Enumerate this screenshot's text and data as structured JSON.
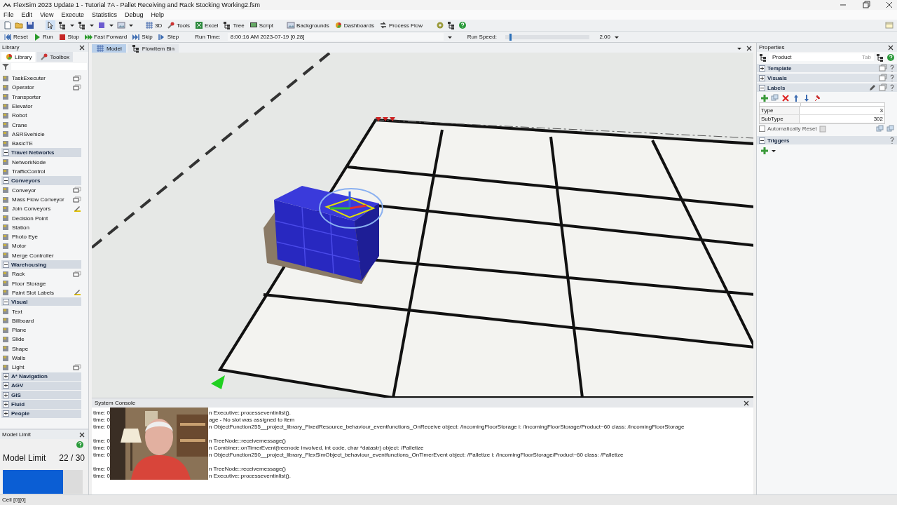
{
  "window": {
    "title": "FlexSim 2023 Update 1 - Tutorial 7A - Pallet Receiving and Rack Stocking Working2.fsm"
  },
  "menu": [
    "File",
    "Edit",
    "View",
    "Execute",
    "Statistics",
    "Debug",
    "Help"
  ],
  "toolbar": {
    "buttons": [
      {
        "label": "3D"
      },
      {
        "label": "Tools"
      },
      {
        "label": "Excel"
      },
      {
        "label": "Tree"
      },
      {
        "label": "Script"
      },
      {
        "label": "Backgrounds"
      },
      {
        "label": "Dashboards"
      },
      {
        "label": "Process Flow"
      }
    ]
  },
  "run_controls": {
    "buttons": [
      "Reset",
      "Run",
      "Stop",
      "Fast Forward",
      "Skip",
      "Step"
    ],
    "run_time_label": "Run Time:",
    "run_time": "8:00:16 AM  2023-07-19  [0.28]",
    "run_speed_label": "Run Speed:",
    "run_speed": {
      "level": 0.05
    },
    "run_speed_value": "2.00"
  },
  "library": {
    "title": "Library",
    "tabs": [
      {
        "label": "Library",
        "selected": true
      },
      {
        "label": "Toolbox",
        "selected": false
      }
    ],
    "items": [
      {
        "kind": "placeable",
        "label": "TaskExecuter"
      },
      {
        "kind": "placeable",
        "label": "Operator"
      },
      {
        "kind": "object",
        "label": "Transporter"
      },
      {
        "kind": "object",
        "label": "Elevator"
      },
      {
        "kind": "object",
        "label": "Robot"
      },
      {
        "kind": "object",
        "label": "Crane"
      },
      {
        "kind": "object",
        "label": "ASRSvehicle"
      },
      {
        "kind": "object",
        "label": "BasicTE"
      },
      {
        "kind": "category",
        "label": "Travel Networks",
        "expanded": true,
        "children": [
          {
            "kind": "object",
            "label": "NetworkNode"
          },
          {
            "kind": "object",
            "label": "TrafficControl"
          }
        ]
      },
      {
        "kind": "category",
        "label": "Conveyors",
        "expanded": true,
        "children": [
          {
            "kind": "placeable",
            "label": "Conveyor"
          },
          {
            "kind": "placeable",
            "label": "Mass Flow Conveyor"
          },
          {
            "kind": "tool",
            "label": "Join Conveyors"
          },
          {
            "kind": "object",
            "label": "Decision Point"
          },
          {
            "kind": "object",
            "label": "Station"
          },
          {
            "kind": "object",
            "label": "Photo Eye"
          },
          {
            "kind": "object",
            "label": "Motor"
          },
          {
            "kind": "object",
            "label": "Merge Controller"
          }
        ]
      },
      {
        "kind": "category",
        "label": "Warehousing",
        "expanded": true,
        "children": [
          {
            "kind": "placeable",
            "label": "Rack"
          },
          {
            "kind": "object",
            "label": "Floor Storage"
          },
          {
            "kind": "tool",
            "label": "Paint Slot Labels"
          }
        ]
      },
      {
        "kind": "category",
        "label": "Visual",
        "expanded": true,
        "children": [
          {
            "kind": "object",
            "label": "Text"
          },
          {
            "kind": "object",
            "label": "Billboard"
          },
          {
            "kind": "object",
            "label": "Plane"
          },
          {
            "kind": "object",
            "label": "Slide"
          },
          {
            "kind": "object",
            "label": "Shape"
          },
          {
            "kind": "object",
            "label": "Walls"
          },
          {
            "kind": "placeable",
            "label": "Light"
          }
        ]
      },
      {
        "kind": "category",
        "label": "A* Navigation",
        "expanded": false
      },
      {
        "kind": "category",
        "label": "AGV",
        "expanded": false
      },
      {
        "kind": "category",
        "label": "GIS",
        "expanded": false
      },
      {
        "kind": "category",
        "label": "Fluid",
        "expanded": false
      },
      {
        "kind": "category",
        "label": "People",
        "expanded": false
      }
    ]
  },
  "model_limit": {
    "title": "Model Limit",
    "label": "Model Limit",
    "count": "22 / 30",
    "level": 0.75
  },
  "document_tabs": [
    {
      "label": "Model",
      "selected": true
    },
    {
      "label": "FlowItem Bin",
      "selected": false
    }
  ],
  "console": {
    "title": "System Console",
    "lines": [
      {
        "prefix": "time: 0",
        "text": "n Executive::processeventinlist().",
        "blank_before": false
      },
      {
        "prefix": "time: 0",
        "text": "age - No slot was assigned to item",
        "blank_before": false
      },
      {
        "prefix": "time: 0",
        "text": "n ObjectFunction255__project_library_FixedResource_behaviour_eventfunctions_OnReceive object: /IncomingFloorStorage i: /IncomingFloorStorage/Product~60 class: /IncomingFloorStorage",
        "blank_before": false
      },
      {
        "prefix": "time: 0",
        "text": "n TreeNode::receivemessage()",
        "blank_before": true
      },
      {
        "prefix": "time: 0",
        "text": "n Combiner::onTimerEvent(treenode involved, int code, char *datastr) object: /Palletize",
        "blank_before": false
      },
      {
        "prefix": "time: 0",
        "text": "n ObjectFunction250__project_library_FlexSimObject_behaviour_eventfunctions_OnTimerEvent object: /Palletize i: /IncomingFloorStorage/Product~60 class: /Palletize",
        "blank_before": false
      },
      {
        "prefix": "time: 0",
        "text": "n TreeNode::receivemessage()",
        "blank_before": true
      },
      {
        "prefix": "time: 0",
        "text": "n Executive::processeventinlist().",
        "blank_before": false
      }
    ]
  },
  "properties": {
    "title": "Properties",
    "object": "Product",
    "tab_button": "Tab",
    "sections": [
      {
        "title": "Template",
        "expanded": false
      },
      {
        "title": "Visuals",
        "expanded": false
      },
      {
        "title": "Labels",
        "expanded": true,
        "labels": [
          {
            "name": "Type",
            "value": "3"
          },
          {
            "name": "SubType",
            "value": "302"
          }
        ],
        "auto_reset": {
          "label": "Automatically Reset",
          "checked": false
        }
      },
      {
        "title": "Triggers",
        "expanded": true
      }
    ]
  },
  "status_bar": "Cell [0][0]"
}
